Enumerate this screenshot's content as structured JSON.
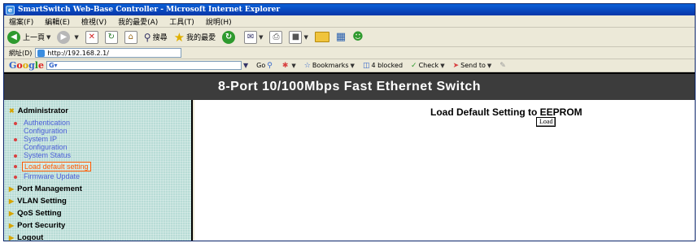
{
  "window": {
    "title": "SmartSwitch Web-Base Controller - Microsoft Internet Explorer"
  },
  "menu": [
    "檔案(F)",
    "編輯(E)",
    "檢視(V)",
    "我的最愛(A)",
    "工具(T)",
    "說明(H)"
  ],
  "toolbar": {
    "back": "上一頁",
    "search": "搜尋",
    "favorites": "我的最愛"
  },
  "address": {
    "label": "網址(D)",
    "url": "http://192.168.2.1/"
  },
  "google_bar": {
    "logo": "Google",
    "go": "Go",
    "bookmarks": "Bookmarks",
    "blocked": "4 blocked",
    "check": "Check",
    "send_to": "Send to"
  },
  "header": {
    "title": "8-Port 10/100Mbps  Fast Ethernet Switch"
  },
  "sidebar": {
    "administrator": "Administrator",
    "items": [
      "Authentication Configuration",
      "System IP Configuration",
      "System Status",
      "Load default setting",
      "Firmware Update"
    ],
    "sections": [
      "Port Management",
      "VLAN Setting",
      "QoS Setting",
      "Port Security",
      "Logout"
    ]
  },
  "content": {
    "title": "Load Default Setting to EEPROM",
    "button": "Load"
  },
  "colors": {
    "header_bg": "#3c3c3c",
    "sidebar_bg": "#b8dcd6",
    "link": "#4a5ed8",
    "active_link": "#ff5a00"
  }
}
